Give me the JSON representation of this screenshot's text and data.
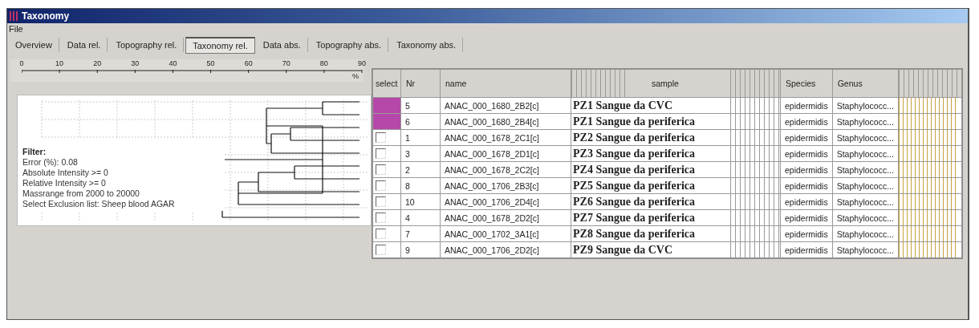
{
  "window": {
    "title": "Taxonomy"
  },
  "menu": [
    "File"
  ],
  "tabs": [
    {
      "label": "Overview",
      "selected": false
    },
    {
      "label": "Data rel.",
      "selected": false
    },
    {
      "label": "Topography rel.",
      "selected": false
    },
    {
      "label": "Taxonomy rel.",
      "selected": true
    },
    {
      "label": "Data abs.",
      "selected": false
    },
    {
      "label": "Topography abs.",
      "selected": false
    },
    {
      "label": "Taxonomy abs.",
      "selected": false
    }
  ],
  "scale": {
    "ticks": [
      "0",
      "10",
      "20",
      "30",
      "40",
      "50",
      "60",
      "70",
      "80",
      "90"
    ],
    "unit": "%"
  },
  "filter": {
    "title": "Filter:",
    "lines": [
      "Error (%): 0.08",
      "Absolute Intensity >= 0",
      "Relative Intensity >= 0",
      "Massrange from 2000 to 20000",
      "Select Exclusion list: Sheep blood AGAR"
    ]
  },
  "table": {
    "columns": [
      "select",
      "Nr",
      "name",
      "sample",
      "Species",
      "Genus"
    ],
    "rows": [
      {
        "selected": true,
        "nr": "5",
        "name": "ANAC_000_1680_2B2[c]",
        "sample": "PZ1 Sangue da CVC",
        "species": "epidermidis",
        "genus": "Staphylococc..."
      },
      {
        "selected": true,
        "nr": "6",
        "name": "ANAC_000_1680_2B4[c]",
        "sample": "PZ1 Sangue da periferica",
        "species": "epidermidis",
        "genus": "Staphylococc..."
      },
      {
        "selected": false,
        "nr": "1",
        "name": "ANAC_000_1678_2C1[c]",
        "sample": "PZ2 Sangue da periferica",
        "species": "epidermidis",
        "genus": "Staphylococc..."
      },
      {
        "selected": false,
        "nr": "3",
        "name": "ANAC_000_1678_2D1[c]",
        "sample": "PZ3 Sangue da periferica",
        "species": "epidermidis",
        "genus": "Staphylococc..."
      },
      {
        "selected": false,
        "nr": "2",
        "name": "ANAC_000_1678_2C2[c]",
        "sample": "PZ4 Sangue da periferica",
        "species": "epidermidis",
        "genus": "Staphylococc..."
      },
      {
        "selected": false,
        "nr": "8",
        "name": "ANAC_000_1706_2B3[c]",
        "sample": "PZ5 Sangue da periferica",
        "species": "epidermidis",
        "genus": "Staphylococc..."
      },
      {
        "selected": false,
        "nr": "10",
        "name": "ANAC_000_1706_2D4[c]",
        "sample": "PZ6 Sangue da periferica",
        "species": "epidermidis",
        "genus": "Staphylococc..."
      },
      {
        "selected": false,
        "nr": "4",
        "name": "ANAC_000_1678_2D2[c]",
        "sample": "PZ7 Sangue da periferica",
        "species": "epidermidis",
        "genus": "Staphylococc..."
      },
      {
        "selected": false,
        "nr": "7",
        "name": "ANAC_000_1702_3A1[c]",
        "sample": "PZ8 Sangue da periferica",
        "species": "epidermidis",
        "genus": "Staphylococc..."
      },
      {
        "selected": false,
        "nr": "9",
        "name": "ANAC_000_1706_2D2[c]",
        "sample": "PZ9 Sangue da CVC",
        "species": "epidermidis",
        "genus": "Staphylococc..."
      }
    ]
  }
}
